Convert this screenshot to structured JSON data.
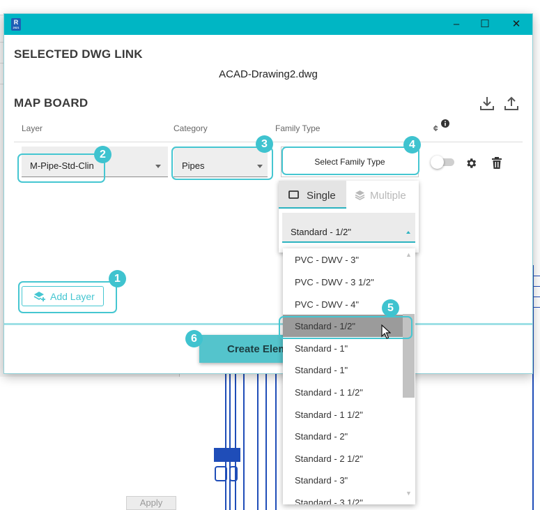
{
  "dialog": {
    "app_icon": "R",
    "app_icon_sub": "2021",
    "window_controls": {
      "minimize": "–",
      "maximize": "☐",
      "close": "✕"
    }
  },
  "dwg_section": {
    "title": "SELECTED DWG LINK",
    "filename": "ACAD-Drawing2.dwg"
  },
  "map_board": {
    "title": "MAP BOARD",
    "columns": {
      "layer": "Layer",
      "category": "Category",
      "family_type": "Family Type",
      "cl_symbol": "¢"
    },
    "row": {
      "layer_value": "M-Pipe-Std-Clin",
      "category_value": "Pipes",
      "family_button": "Select Family Type",
      "toggle_on": false
    }
  },
  "add_layer_label": "Add Layer",
  "create_button": "Create Elem",
  "family_popover": {
    "tab_single": "Single",
    "tab_multiple": "Multiple",
    "active_tab": "Single",
    "selected_value": "Standard - 1/2\"",
    "options": [
      "PVC - DWV - 3\"",
      "PVC - DWV - 3 1/2\"",
      "PVC - DWV - 4\"",
      "Standard - 1/2\"",
      "Standard - 1\"",
      "Standard - 1\"",
      "Standard - 1 1/2\"",
      "Standard - 1 1/2\"",
      "Standard - 2\"",
      "Standard - 2 1/2\"",
      "Standard - 3\"",
      "Standard - 3 1/2\""
    ],
    "highlighted_index": 3
  },
  "callouts": [
    "1",
    "2",
    "3",
    "4",
    "5",
    "6"
  ],
  "background": {
    "apply_label": "Apply"
  },
  "icons": [
    "revit-app-icon",
    "download-icon",
    "upload-icon",
    "info-icon",
    "gear-icon",
    "trash-icon",
    "add-layer-icon",
    "single-icon",
    "multiple-icon",
    "mouse-cursor-icon"
  ],
  "colors": {
    "accent": "#00b6c4",
    "callout": "#3fc3cf",
    "highlight_outline": "#45c6d1",
    "pipe_lines": "#1f4db8"
  }
}
